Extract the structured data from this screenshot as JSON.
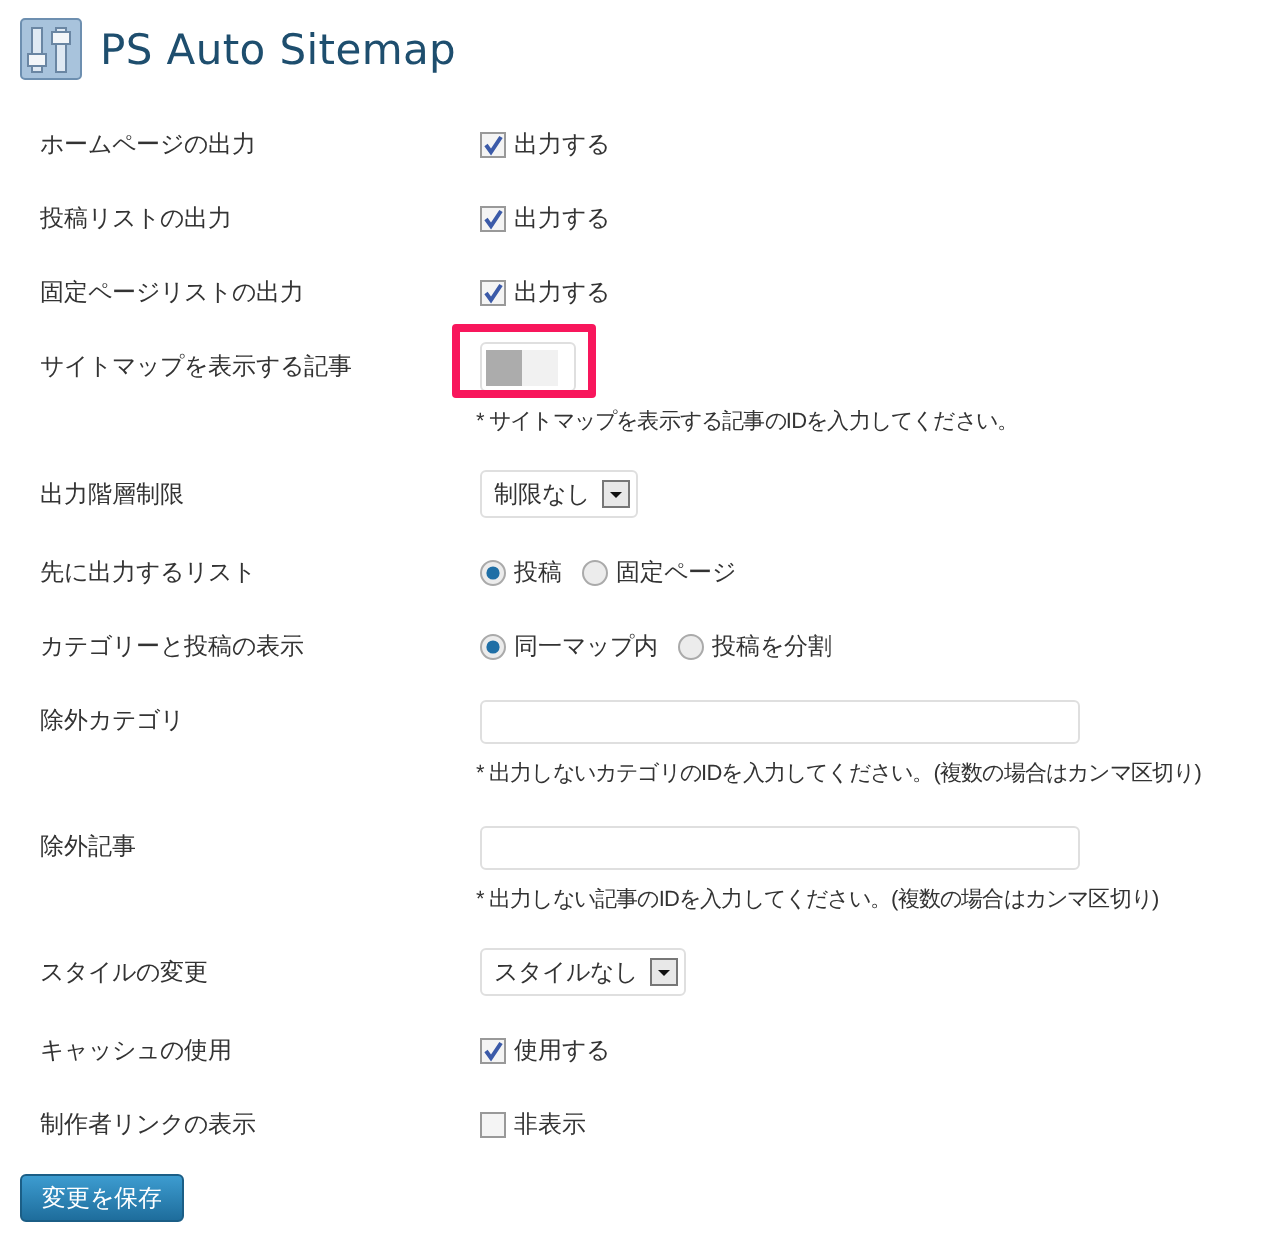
{
  "title": "PS Auto Sitemap",
  "rows": [
    {
      "kind": "checkbox",
      "label": "ホームページの出力",
      "option": "出力する",
      "checked": true
    },
    {
      "kind": "checkbox",
      "label": "投稿リストの出力",
      "option": "出力する",
      "checked": true
    },
    {
      "kind": "checkbox",
      "label": "固定ページリストの出力",
      "option": "出力する",
      "checked": true
    },
    {
      "kind": "text",
      "label": "サイトマップを表示する記事",
      "masked": true,
      "highlighted": true,
      "note": "* サイトマップを表示する記事のIDを入力してください。"
    },
    {
      "kind": "select",
      "label": "出力階層制限",
      "value": "制限なし"
    },
    {
      "kind": "radio",
      "label": "先に出力するリスト",
      "options": [
        {
          "label": "投稿",
          "selected": true
        },
        {
          "label": "固定ページ",
          "selected": false
        }
      ]
    },
    {
      "kind": "radio",
      "label": "カテゴリーと投稿の表示",
      "options": [
        {
          "label": "同一マップ内",
          "selected": true
        },
        {
          "label": "投稿を分割",
          "selected": false
        }
      ]
    },
    {
      "kind": "text",
      "label": "除外カテゴリ",
      "note": "* 出力しないカテゴリのIDを入力してください。(複数の場合はカンマ区切り)"
    },
    {
      "kind": "text",
      "label": "除外記事",
      "note": "* 出力しない記事のIDを入力してください。(複数の場合はカンマ区切り)"
    },
    {
      "kind": "select",
      "label": "スタイルの変更",
      "value": "スタイルなし"
    },
    {
      "kind": "checkbox",
      "label": "キャッシュの使用",
      "option": "使用する",
      "checked": true
    },
    {
      "kind": "checkbox",
      "label": "制作者リンクの表示",
      "option": "非表示",
      "checked": false
    }
  ],
  "save_button": "変更を保存"
}
